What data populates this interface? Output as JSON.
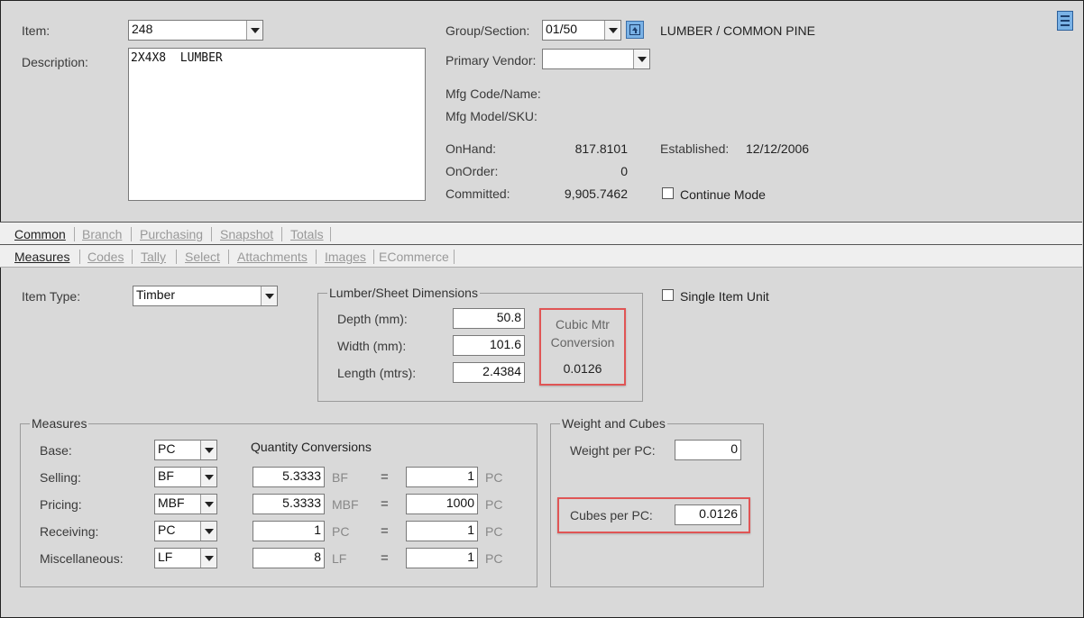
{
  "header": {
    "item_label": "Item:",
    "item_value": "248",
    "description_label": "Description:",
    "description_value": "2X4X8  LUMBER",
    "group_section_label": "Group/Section:",
    "group_section_value": "01/50",
    "group_section_name": "LUMBER / COMMON PINE",
    "primary_vendor_label": "Primary Vendor:",
    "primary_vendor_value": "",
    "mfg_code_label": "Mfg Code/Name:",
    "mfg_model_label": "Mfg Model/SKU:",
    "onhand_label": "OnHand:",
    "onhand_value": "817.8101",
    "onorder_label": "OnOrder:",
    "onorder_value": "0",
    "committed_label": "Committed:",
    "committed_value": "9,905.7462",
    "established_label": "Established:",
    "established_value": "12/12/2006",
    "continue_mode_label": "Continue Mode"
  },
  "tabs_top": [
    "Common",
    "Branch",
    "Purchasing",
    "Snapshot",
    "Totals"
  ],
  "tabs_sub": [
    "Measures",
    "Codes",
    "Tally",
    "Select",
    "Attachments",
    "Images",
    "ECommerce"
  ],
  "measures_tab": {
    "item_type_label": "Item Type:",
    "item_type_value": "Timber",
    "single_item_unit_label": "Single Item Unit",
    "dimensions": {
      "title": "Lumber/Sheet Dimensions",
      "depth_label": "Depth (mm):",
      "depth_value": "50.8",
      "width_label": "Width   (mm):",
      "width_value": "101.6",
      "length_label": "Length (mtrs):",
      "length_value": "2.4384",
      "cubic_title_1": "Cubic Mtr",
      "cubic_title_2": "Conversion",
      "cubic_value": "0.0126"
    },
    "measures": {
      "title": "Measures",
      "quantity_conversions_label": "Quantity Conversions",
      "equals": "=",
      "rows": [
        {
          "label": "Base:",
          "unit": "PC"
        },
        {
          "label": "Selling:",
          "unit": "BF",
          "left_value": "5.3333",
          "left_unit": "BF",
          "right_value": "1",
          "right_unit": "PC"
        },
        {
          "label": "Pricing:",
          "unit": "MBF",
          "left_value": "5.3333",
          "left_unit": "MBF",
          "right_value": "1000",
          "right_unit": "PC"
        },
        {
          "label": "Receiving:",
          "unit": "PC",
          "left_value": "1",
          "left_unit": "PC",
          "right_value": "1",
          "right_unit": "PC"
        },
        {
          "label": "Miscellaneous:",
          "unit": "LF",
          "left_value": "8",
          "left_unit": "LF",
          "right_value": "1",
          "right_unit": "PC"
        }
      ]
    },
    "weight_cubes": {
      "title": "Weight and Cubes",
      "weight_label": "Weight per PC:",
      "weight_value": "0",
      "cubes_label": "Cubes per PC:",
      "cubes_value": "0.0126"
    }
  },
  "colors": {
    "background": "#d9d9d9",
    "highlight": "#e05555",
    "icon_blue": "#7ab2e6"
  }
}
